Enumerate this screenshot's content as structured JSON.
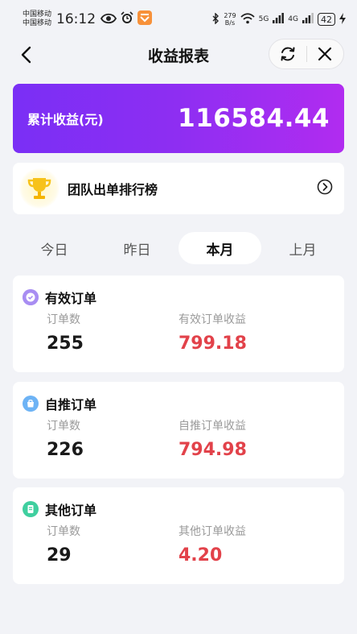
{
  "status_bar": {
    "carrier_1": "中国移动",
    "carrier_2": "中国移动",
    "time": "16:12",
    "net_speed_value": "279",
    "net_speed_unit": "B/s",
    "net_type_1": "5G",
    "net_type_2": "4G",
    "battery": "42"
  },
  "header": {
    "title": "收益报表",
    "back_icon": "chevron-left-icon",
    "refresh_icon": "refresh-icon",
    "close_icon": "close-icon"
  },
  "total": {
    "label": "累计收益(元)",
    "value": "116584.44"
  },
  "ranking": {
    "label": "团队出单排行榜",
    "icon": "trophy-icon"
  },
  "tabs": [
    {
      "label": "今日",
      "active": false
    },
    {
      "label": "昨日",
      "active": false
    },
    {
      "label": "本月",
      "active": true
    },
    {
      "label": "上月",
      "active": false
    }
  ],
  "cards": [
    {
      "title": "有效订单",
      "icon": "check-badge-icon",
      "icon_color": "#9b7cf0",
      "count_label": "订单数",
      "count": "255",
      "amount_label": "有效订单收益",
      "amount": "799.18"
    },
    {
      "title": "自推订单",
      "icon": "shopping-bag-icon",
      "icon_color": "#5aa8f2",
      "count_label": "订单数",
      "count": "226",
      "amount_label": "自推订单收益",
      "amount": "794.98"
    },
    {
      "title": "其他订单",
      "icon": "document-icon",
      "icon_color": "#3fcf9f",
      "count_label": "订单数",
      "count": "29",
      "amount_label": "其他订单收益",
      "amount": "4.20"
    }
  ],
  "colors": {
    "accent_gradient_start": "#7a2ff5",
    "accent_gradient_end": "#b12cf0",
    "amount_red": "#e2424a",
    "page_background": "#f2f3f7"
  }
}
